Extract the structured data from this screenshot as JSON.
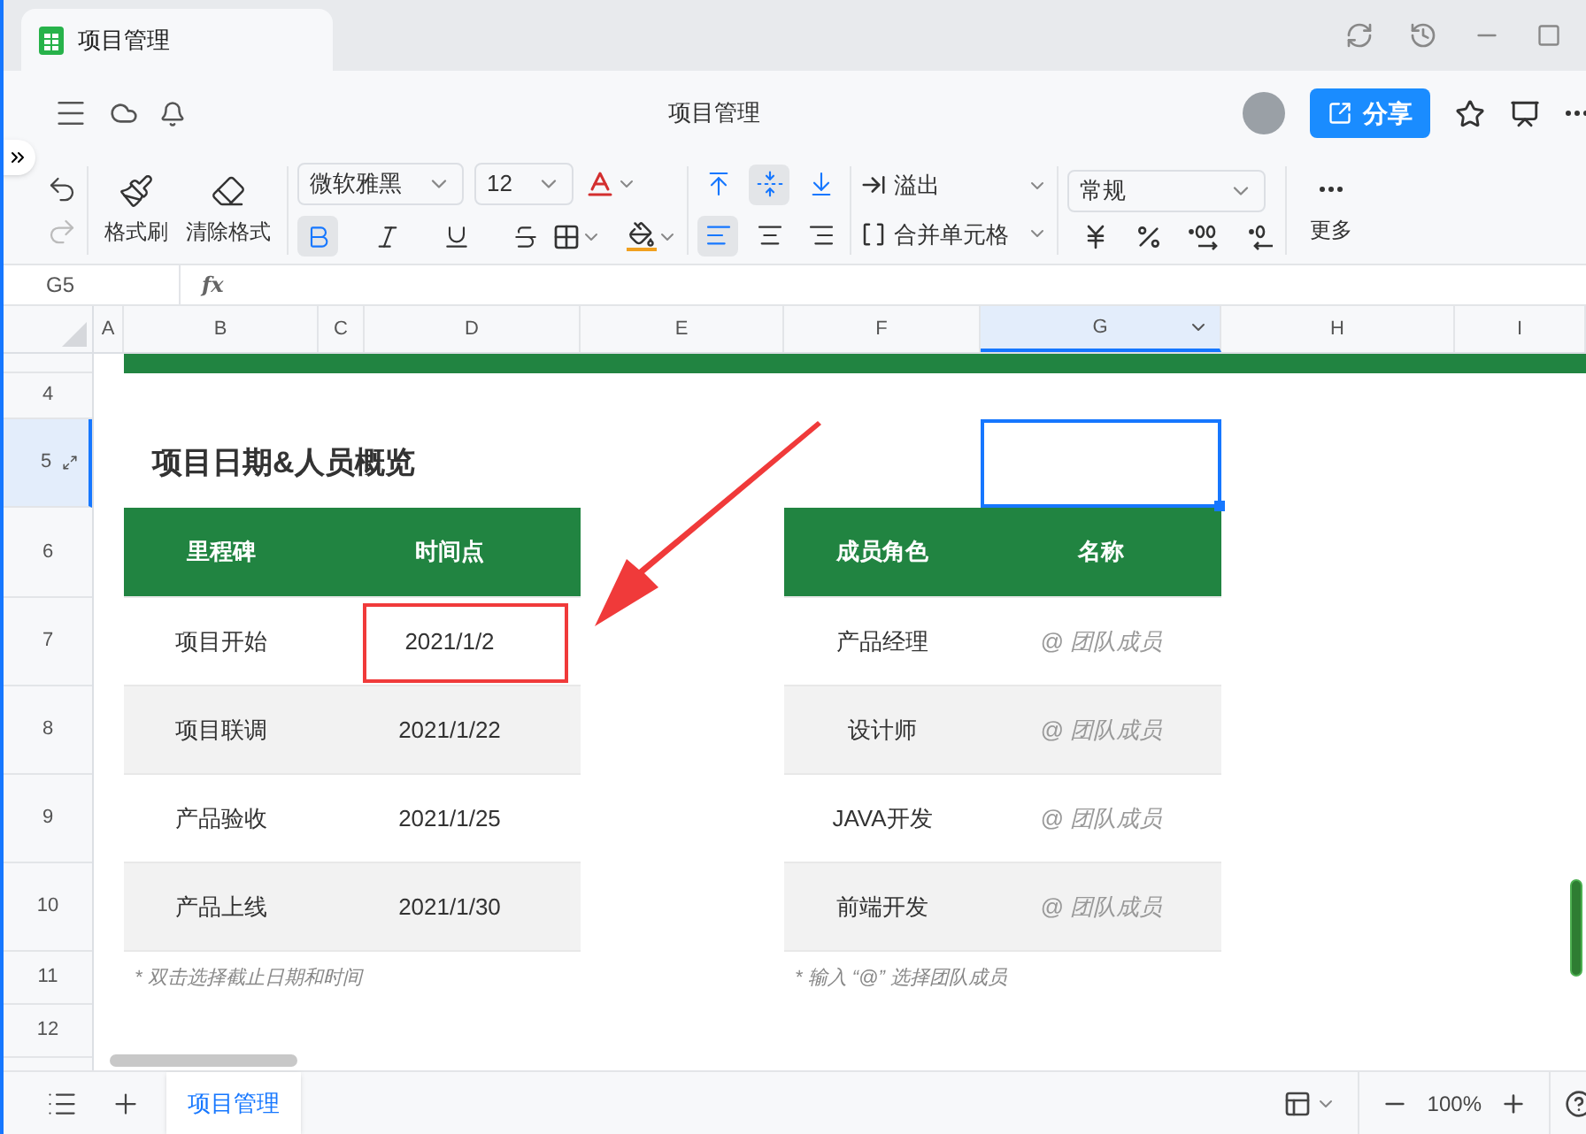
{
  "window": {
    "tab_title": "项目管理"
  },
  "header": {
    "title": "项目管理",
    "share": "分享"
  },
  "toolbar": {
    "format_painter": "格式刷",
    "clear_format": "清除格式",
    "font": "微软雅黑",
    "font_size": "12",
    "overflow": "溢出",
    "merge": "合并单元格",
    "number_format": "常规",
    "more": "更多",
    "text_styles": [
      {
        "kind": "bold",
        "selected": true
      },
      {
        "kind": "italic",
        "selected": false
      },
      {
        "kind": "underline",
        "selected": false
      },
      {
        "kind": "strike",
        "selected": false
      }
    ],
    "vertical_align": [
      {
        "kind": "top",
        "selected": false
      },
      {
        "kind": "middle",
        "selected": true
      },
      {
        "kind": "bottom",
        "selected": false
      }
    ],
    "horizontal_align": [
      {
        "kind": "left",
        "selected": true
      },
      {
        "kind": "center",
        "selected": false
      },
      {
        "kind": "right",
        "selected": false
      }
    ]
  },
  "formula_bar": {
    "cell_ref": "G5",
    "fx": "fx"
  },
  "columns": [
    {
      "label": "A",
      "selected": false
    },
    {
      "label": "B",
      "selected": false
    },
    {
      "label": "C",
      "selected": false
    },
    {
      "label": "D",
      "selected": false
    },
    {
      "label": "E",
      "selected": false
    },
    {
      "label": "F",
      "selected": false
    },
    {
      "label": "G",
      "selected": true
    },
    {
      "label": "H",
      "selected": false
    },
    {
      "label": "I",
      "selected": false
    }
  ],
  "rows": [
    {
      "label": "4",
      "selected": false
    },
    {
      "label": "5",
      "selected": true
    },
    {
      "label": "6",
      "selected": false
    },
    {
      "label": "7",
      "selected": false
    },
    {
      "label": "8",
      "selected": false
    },
    {
      "label": "9",
      "selected": false
    },
    {
      "label": "10",
      "selected": false
    },
    {
      "label": "11",
      "selected": false
    },
    {
      "label": "12",
      "selected": false
    }
  ],
  "sheet": {
    "title": "项目日期&人员概览",
    "milestones": {
      "headers": [
        "里程碑",
        "时间点"
      ],
      "rows": [
        [
          "项目开始",
          "2021/1/2"
        ],
        [
          "项目联调",
          "2021/1/22"
        ],
        [
          "产品验收",
          "2021/1/25"
        ],
        [
          "产品上线",
          "2021/1/30"
        ]
      ],
      "note": "* 双击选择截止日期和时间"
    },
    "members": {
      "headers": [
        "成员角色",
        "名称"
      ],
      "rows": [
        [
          "产品经理",
          "@ 团队成员"
        ],
        [
          "设计师",
          "@ 团队成员"
        ],
        [
          "JAVA开发",
          "@ 团队成员"
        ],
        [
          "前端开发",
          "@ 团队成员"
        ]
      ],
      "note": "* 输入 “@” 选择团队成员"
    }
  },
  "sheet_tabs": [
    {
      "label": "项目管理",
      "selected": true
    }
  ],
  "zoom": "100%"
}
